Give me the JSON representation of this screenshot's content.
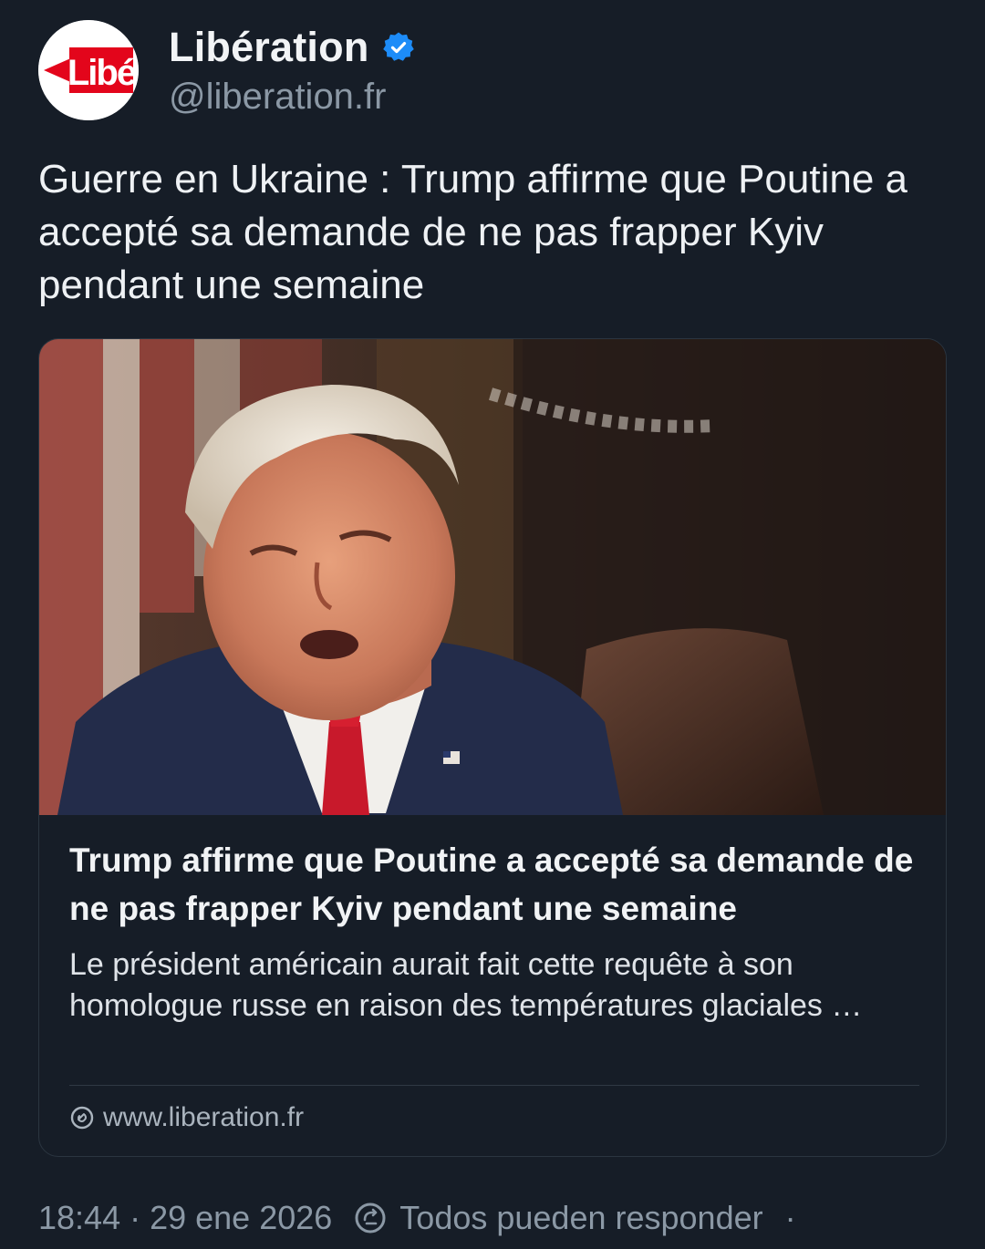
{
  "author": {
    "display_name": "Libération",
    "handle": "@liberation.fr",
    "avatar_text": "Libé",
    "verified_icon": "verified-badge-icon",
    "verified_color": "#1d8cf8"
  },
  "post": {
    "text": "Guerre en Ukraine : Trump affirme que Poutine a accepté sa demande de ne pas frapper Kyiv pendant une semaine"
  },
  "link_card": {
    "image_icon": "article-photo",
    "title": "Trump affirme que Poutine a accepté sa demande de ne pas frapper Kyiv pendant une semaine",
    "description": "Le président américain aurait fait cette requête à son homologue russe en raison des températures glaciales …",
    "source_icon": "link-globe-icon",
    "source": "www.liberation.fr"
  },
  "meta": {
    "time": "18:44",
    "separator": "·",
    "date": "29 ene 2026",
    "reply_icon": "reply-settings-icon",
    "reply_setting": "Todos pueden responder",
    "trailing": "·"
  },
  "colors": {
    "background": "#161d27",
    "border": "#2b3540",
    "secondary_text": "#8b98a5",
    "brand_red": "#e3051b"
  }
}
